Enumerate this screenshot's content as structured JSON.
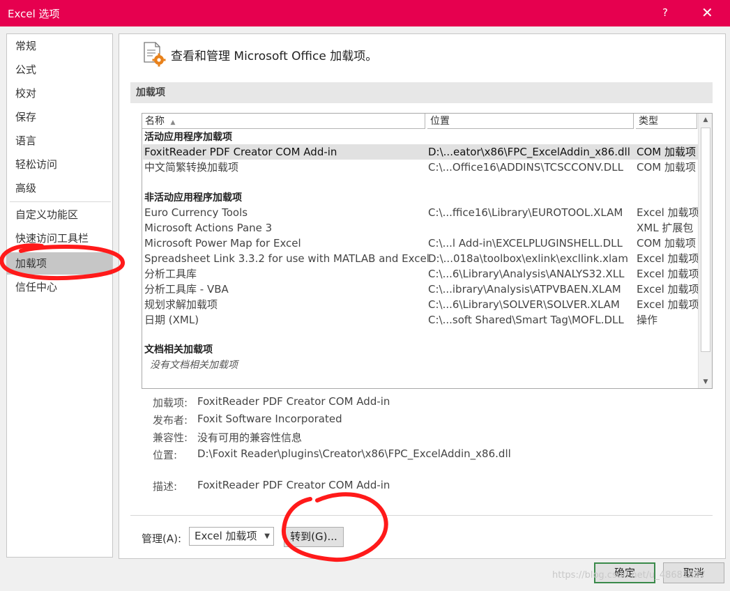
{
  "window": {
    "title": "Excel 选项",
    "help": "?",
    "close": "✕"
  },
  "nav": {
    "items": [
      {
        "label": "常规"
      },
      {
        "label": "公式"
      },
      {
        "label": "校对"
      },
      {
        "label": "保存"
      },
      {
        "label": "语言"
      },
      {
        "label": "轻松访问"
      },
      {
        "label": "高级"
      },
      {
        "label": "自定义功能区"
      },
      {
        "label": "快速访问工具栏"
      },
      {
        "label": "加载项",
        "selected": true
      },
      {
        "label": "信任中心"
      }
    ]
  },
  "header": {
    "text": "查看和管理 Microsoft Office 加载项。",
    "icon": "addins-gear-icon"
  },
  "section": {
    "title": "加载项"
  },
  "list": {
    "columns": [
      "名称",
      "位置",
      "类型"
    ],
    "sort_icon": "▲",
    "groups": {
      "active": "活动应用程序加载项",
      "inactive": "非活动应用程序加载项",
      "document": "文档相关加载项",
      "document_empty": "没有文档相关加载项"
    },
    "active_rows": [
      {
        "name": "FoxitReader PDF Creator COM Add-in",
        "location": "D:\\...eator\\x86\\FPC_ExcelAddin_x86.dll",
        "type": "COM 加载项",
        "selected": true
      },
      {
        "name": "中文简繁转换加载项",
        "location": "C:\\...Office16\\ADDINS\\TCSCCONV.DLL",
        "type": "COM 加载项"
      }
    ],
    "inactive_rows": [
      {
        "name": "Euro Currency Tools",
        "location": "C:\\...ffice16\\Library\\EUROTOOL.XLAM",
        "type": "Excel 加载项"
      },
      {
        "name": "Microsoft Actions Pane 3",
        "location": "",
        "type": "XML 扩展包"
      },
      {
        "name": "Microsoft Power Map for Excel",
        "location": "C:\\...l Add-in\\EXCELPLUGINSHELL.DLL",
        "type": "COM 加载项"
      },
      {
        "name": "Spreadsheet Link 3.3.2 for use with MATLAB and Excel",
        "location": "D:\\...018a\\toolbox\\exlink\\excllink.xlam",
        "type": "Excel 加载项"
      },
      {
        "name": "分析工具库",
        "location": "C:\\...6\\Library\\Analysis\\ANALYS32.XLL",
        "type": "Excel 加载项"
      },
      {
        "name": "分析工具库 - VBA",
        "location": "C:\\...ibrary\\Analysis\\ATPVBAEN.XLAM",
        "type": "Excel 加载项"
      },
      {
        "name": "规划求解加载项",
        "location": "C:\\...6\\Library\\SOLVER\\SOLVER.XLAM",
        "type": "Excel 加载项"
      },
      {
        "name": "日期 (XML)",
        "location": "C:\\...soft Shared\\Smart Tag\\MOFL.DLL",
        "type": "操作"
      }
    ]
  },
  "details": {
    "addin_label": "加载项:",
    "addin": "FoxitReader PDF Creator COM Add-in",
    "publisher_label": "发布者:",
    "publisher": "Foxit Software Incorporated",
    "compat_label": "兼容性:",
    "compat": "没有可用的兼容性信息",
    "location_label": "位置:",
    "location": "D:\\Foxit Reader\\plugins\\Creator\\x86\\FPC_ExcelAddin_x86.dll",
    "desc_label": "描述:",
    "desc": "FoxitReader PDF Creator COM Add-in"
  },
  "manage": {
    "label": "管理(A):",
    "value": "Excel 加载项",
    "goto": "转到(G)..."
  },
  "buttons": {
    "ok": "确定",
    "cancel": "取消"
  },
  "watermark": "https://blog.csdn.net/u_48681807",
  "colors": {
    "titlebar": "#e6004f",
    "annotation": "#ff1a1a"
  }
}
